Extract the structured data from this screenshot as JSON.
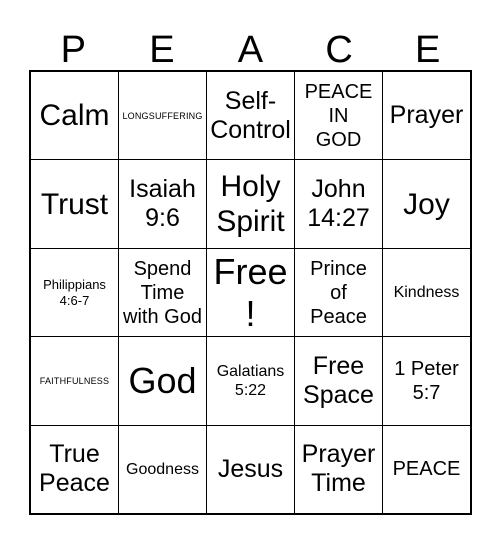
{
  "card": {
    "title_letters": [
      "P",
      "E",
      "A",
      "C",
      "E"
    ],
    "rows": [
      [
        {
          "text": "Calm",
          "size": "fs-lg"
        },
        {
          "text": "LONGSUFFERING",
          "size": "fs-tiny"
        },
        {
          "text": "Self-\nControl",
          "size": "fs-md"
        },
        {
          "text": "PEACE\nIN\nGOD",
          "size": "fs-sm"
        },
        {
          "text": "Prayer",
          "size": "fs-md"
        }
      ],
      [
        {
          "text": "Trust",
          "size": "fs-lg"
        },
        {
          "text": "Isaiah\n9:6",
          "size": "fs-md"
        },
        {
          "text": "Holy\nSpirit",
          "size": "fs-lg"
        },
        {
          "text": "John\n14:27",
          "size": "fs-md"
        },
        {
          "text": "Joy",
          "size": "fs-lg"
        }
      ],
      [
        {
          "text": "Philippians\n4:6-7",
          "size": "fs-xxs"
        },
        {
          "text": "Spend\nTime\nwith God",
          "size": "fs-sm"
        },
        {
          "text": "Free!",
          "size": "fs-xl"
        },
        {
          "text": "Prince\nof\nPeace",
          "size": "fs-sm"
        },
        {
          "text": "Kindness",
          "size": "fs-xs"
        }
      ],
      [
        {
          "text": "FAITHFULNESS",
          "size": "fs-tiny"
        },
        {
          "text": "God",
          "size": "fs-xl"
        },
        {
          "text": "Galatians\n5:22",
          "size": "fs-xs"
        },
        {
          "text": "Free\nSpace",
          "size": "fs-md"
        },
        {
          "text": "1 Peter\n5:7",
          "size": "fs-sm"
        }
      ],
      [
        {
          "text": "True\nPeace",
          "size": "fs-md"
        },
        {
          "text": "Goodness",
          "size": "fs-xs"
        },
        {
          "text": "Jesus",
          "size": "fs-md"
        },
        {
          "text": "Prayer\nTime",
          "size": "fs-md"
        },
        {
          "text": "PEACE",
          "size": "fs-sm"
        }
      ]
    ],
    "colors": {
      "background": "#ffffff",
      "text": "#000000",
      "grid_line": "#000000"
    }
  }
}
